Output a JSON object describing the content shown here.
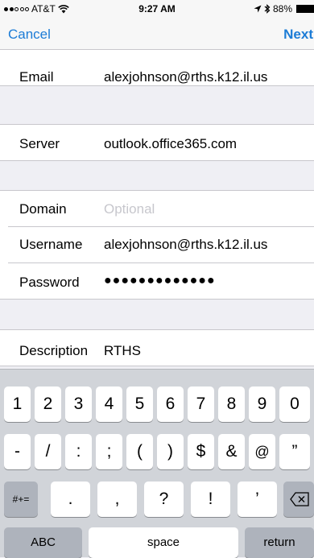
{
  "status": {
    "carrier": "AT&T",
    "time": "9:27 AM",
    "battery": "88%",
    "wifi_icon": "Ὥc",
    "location_icon": "↗",
    "bluetooth_icon": "✱"
  },
  "nav": {
    "cancel": "Cancel",
    "next": "Next"
  },
  "form": {
    "email": {
      "label": "Email",
      "value": "alexjohnson@rths.k12.il.us"
    },
    "server": {
      "label": "Server",
      "value": "outlook.office365.com"
    },
    "domain": {
      "label": "Domain",
      "placeholder": "Optional"
    },
    "username": {
      "label": "Username",
      "value": "alexjohnson@rths.k12.il.us"
    },
    "password": {
      "label": "Password",
      "value": "●●●●●●●●●●●●●"
    },
    "description": {
      "label": "Description",
      "value": "RTHS"
    }
  },
  "keyboard": {
    "row1": [
      "1",
      "2",
      "3",
      "4",
      "5",
      "6",
      "7",
      "8",
      "9",
      "0"
    ],
    "row2": [
      "-",
      "/",
      ":",
      ";",
      "(",
      ")",
      "$",
      "&",
      "@",
      "”"
    ],
    "row3": [
      ".",
      ",",
      "?",
      "!",
      "’"
    ],
    "symbols": "#+=",
    "abc": "ABC",
    "space": "space",
    "return": "return",
    "backspace_icon": "⌫"
  }
}
